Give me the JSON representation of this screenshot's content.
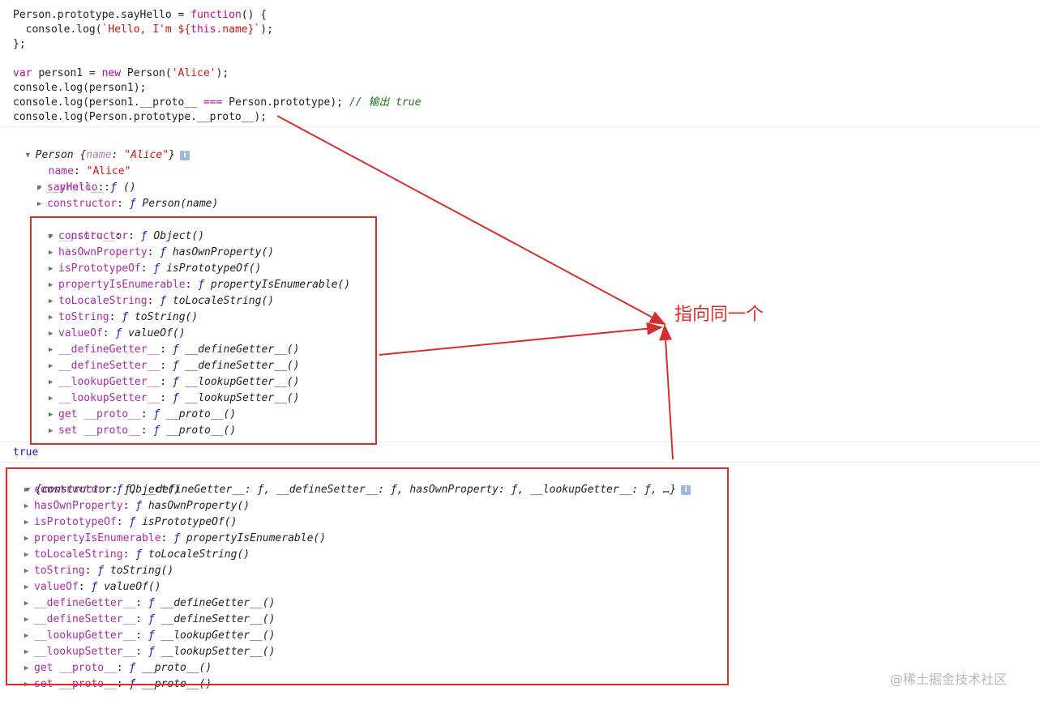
{
  "code": {
    "lines": [
      [
        {
          "t": "Person.prototype.sayHello = "
        },
        {
          "t": "function",
          "c": "kw"
        },
        {
          "t": "() {"
        }
      ],
      [
        {
          "t": "  console.log("
        },
        {
          "t": "`Hello, I'm ${",
          "c": "str"
        },
        {
          "t": "this",
          "c": "kw"
        },
        {
          "t": ".name}`",
          "c": "str"
        },
        {
          "t": ");"
        }
      ],
      [
        {
          "t": "};"
        }
      ],
      [
        {
          "t": ""
        }
      ],
      [
        {
          "t": "var ",
          "c": "kw"
        },
        {
          "t": "person1 = "
        },
        {
          "t": "new ",
          "c": "kw"
        },
        {
          "t": "Person("
        },
        {
          "t": "'Alice'",
          "c": "str"
        },
        {
          "t": ");"
        }
      ],
      [
        {
          "t": "console.log(person1);"
        }
      ],
      [
        {
          "t": "console.log(person1.__proto__ "
        },
        {
          "t": "===",
          "c": "kw"
        },
        {
          "t": " Person.prototype); "
        },
        {
          "t": "// 输出 true",
          "c": "cmt"
        }
      ],
      [
        {
          "t": "console.log(Person.prototype.__proto__);"
        }
      ]
    ]
  },
  "console": {
    "person_header": {
      "name": "Person",
      "summary_key": "name",
      "summary_value": "\"Alice\""
    },
    "name_prop": {
      "key": "name",
      "value": "\"Alice\""
    },
    "proto_label": "__proto__",
    "proto_items": [
      {
        "key": "sayHello",
        "value": "()"
      },
      {
        "key": "constructor",
        "value": "Person(name)"
      }
    ],
    "object_methods": [
      {
        "key": "constructor",
        "value": "Object()"
      },
      {
        "key": "hasOwnProperty",
        "value": "hasOwnProperty()"
      },
      {
        "key": "isPrototypeOf",
        "value": "isPrototypeOf()"
      },
      {
        "key": "propertyIsEnumerable",
        "value": "propertyIsEnumerable()"
      },
      {
        "key": "toLocaleString",
        "value": "toLocaleString()"
      },
      {
        "key": "toString",
        "value": "toString()"
      },
      {
        "key": "valueOf",
        "value": "valueOf()"
      },
      {
        "key": "__defineGetter__",
        "value": "__defineGetter__()"
      },
      {
        "key": "__defineSetter__",
        "value": "__defineSetter__()"
      },
      {
        "key": "__lookupGetter__",
        "value": "__lookupGetter__()"
      },
      {
        "key": "__lookupSetter__",
        "value": "__lookupSetter__()"
      },
      {
        "key": "get __proto__",
        "value": "__proto__()"
      },
      {
        "key": "set __proto__",
        "value": "__proto__()"
      }
    ],
    "true_output": "true",
    "object_summary": "{constructor: ƒ, __defineGetter__: ƒ, __defineSetter__: ƒ, hasOwnProperty: ƒ, __lookupGetter__: ƒ, …}",
    "fn_symbol": "ƒ",
    "info_symbol": "i"
  },
  "annotation": {
    "text": "指向同一个",
    "color": "#d32f2f"
  },
  "watermark": "@稀土掘金技术社区"
}
